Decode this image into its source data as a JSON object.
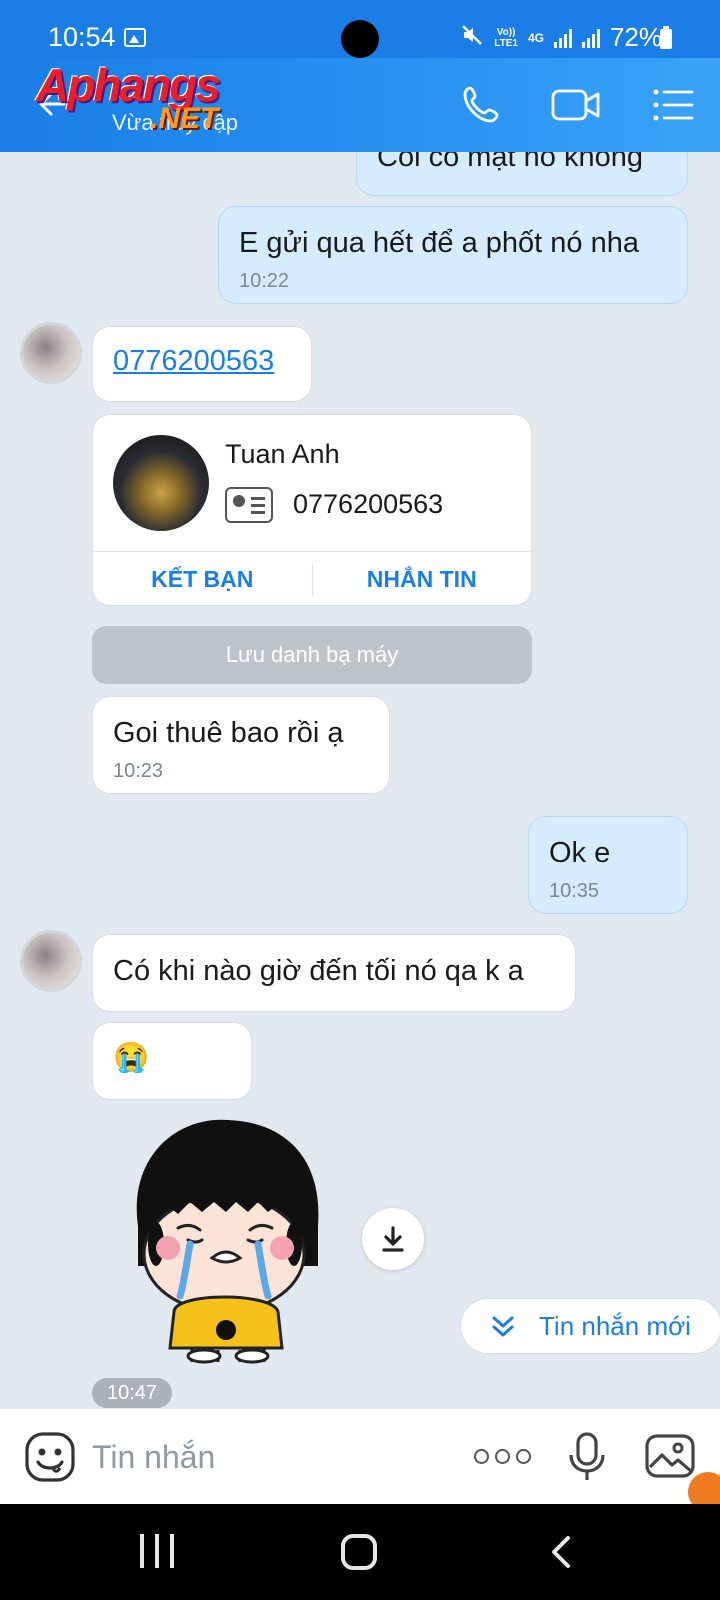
{
  "status_bar": {
    "time": "10:54",
    "battery": "72%",
    "volte": "Vo))\nLTE1",
    "network": "4G"
  },
  "header": {
    "watermark": {
      "logo": "Aphangs",
      "net": ".NET"
    },
    "status": "Vừa truy cập"
  },
  "messages": [
    {
      "side": "me",
      "text": "Coi có mặt nó không",
      "partial": true
    },
    {
      "side": "me",
      "text": "E gửi qua hết để a phốt nó nha",
      "time": "10:22"
    },
    {
      "side": "them",
      "text": "0776200563",
      "type": "link"
    },
    {
      "side": "them",
      "type": "contact_card",
      "name": "Tuan Anh",
      "phone": "0776200563",
      "add_friend": "KẾT BẠN",
      "message": "NHẮN TIN"
    },
    {
      "side": "them",
      "type": "action",
      "text": "Lưu danh bạ máy"
    },
    {
      "side": "them",
      "text": "Goi thuê bao rồi ạ",
      "time": "10:23"
    },
    {
      "side": "me",
      "text": "Ok e",
      "time": "10:35"
    },
    {
      "side": "them",
      "text": "Có khi nào giờ đến tối nó qa k a"
    },
    {
      "side": "them",
      "text": "😭"
    },
    {
      "side": "them",
      "type": "sticker",
      "time": "10:47"
    }
  ],
  "new_messages_label": "Tin nhắn mới",
  "composer": {
    "placeholder": "Tin nhắn"
  },
  "colors": {
    "accent": "#1a7ee6",
    "my_bubble": "#d4ecfe",
    "their_bubble": "#ffffff",
    "chat_bg": "#e2e8f0"
  },
  "icons": [
    "back-arrow-icon",
    "phone-icon",
    "video-call-icon",
    "menu-list-icon",
    "download-icon",
    "double-chevron-down-icon",
    "emoji-icon",
    "more-options-icon",
    "microphone-icon",
    "image-icon"
  ]
}
